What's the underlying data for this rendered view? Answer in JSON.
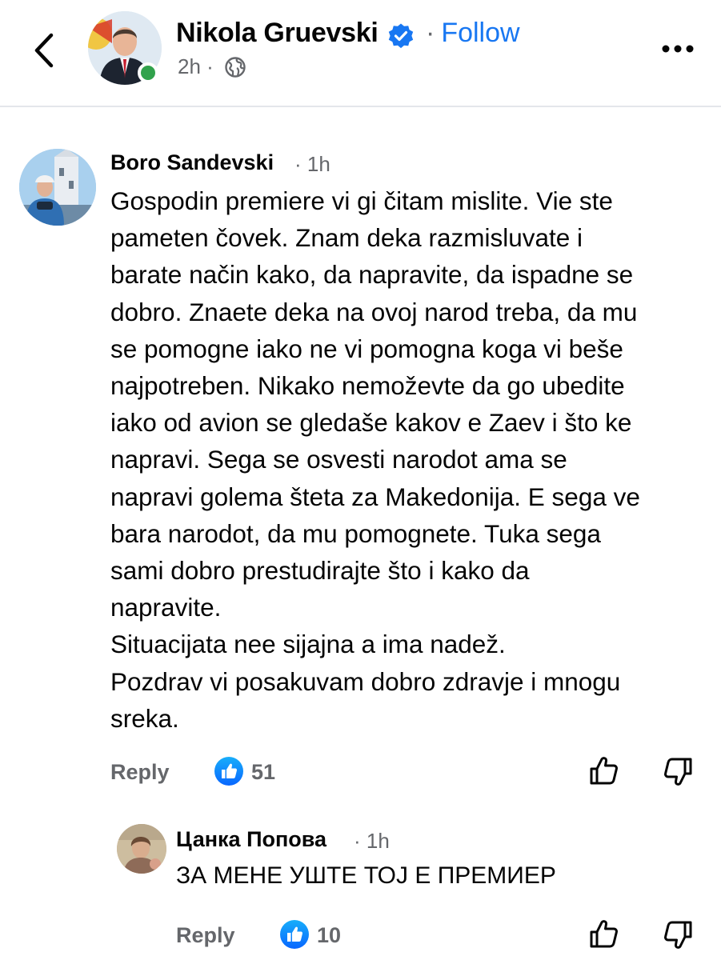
{
  "header": {
    "name": "Nikola Gruevski",
    "follow_separator": "·",
    "follow_label": "Follow",
    "time": "2h",
    "meta_separator": "·",
    "privacy_icon": "globe-icon",
    "back_icon": "chevron-left-icon",
    "more_icon": "more-horizontal-icon",
    "verified_icon": "verified-badge-icon"
  },
  "colors": {
    "accent": "#1877f2",
    "online": "#31a24c",
    "secondary_text": "#65676b"
  },
  "comments": [
    {
      "author": "Boro Sandevski",
      "separator": "·",
      "time": "1h",
      "lines": [
        "Gospodin premiere vi gi čitam mislite. Vie ste",
        "pameten čovek. Znam deka razmisluvate i",
        "barate način kako, da napravite, da ispadne se",
        "dobro. Znaete deka na ovoj narod treba, da mu",
        "se pomogne iako ne vi pomogna koga vi beše",
        "najpotreben. Nikako nemoževte da go ubedite",
        "iako od avion se gledaše kakov e Zaev i što ke",
        "napravi. Sega se osvesti narodot ama se",
        "napravi golema šteta za Makedonija. E sega ve",
        "bara narodot, da mu pomognete. Tuka sega",
        "sami dobro prestudirajte što i kako da",
        "napravite.",
        "Situacijata nee sijajna a ima nadež.",
        "Pozdrav vi posakuvam dobro zdravje i mnogu",
        "sreka."
      ],
      "reply_label": "Reply",
      "like_count": "51"
    },
    {
      "author": "Цанка Попова",
      "separator": "·",
      "time": "1h",
      "text": "ЗА МЕНЕ УШТЕ ТОЈ Е ПРЕМИЕР",
      "reply_label": "Reply",
      "like_count": "10"
    }
  ]
}
